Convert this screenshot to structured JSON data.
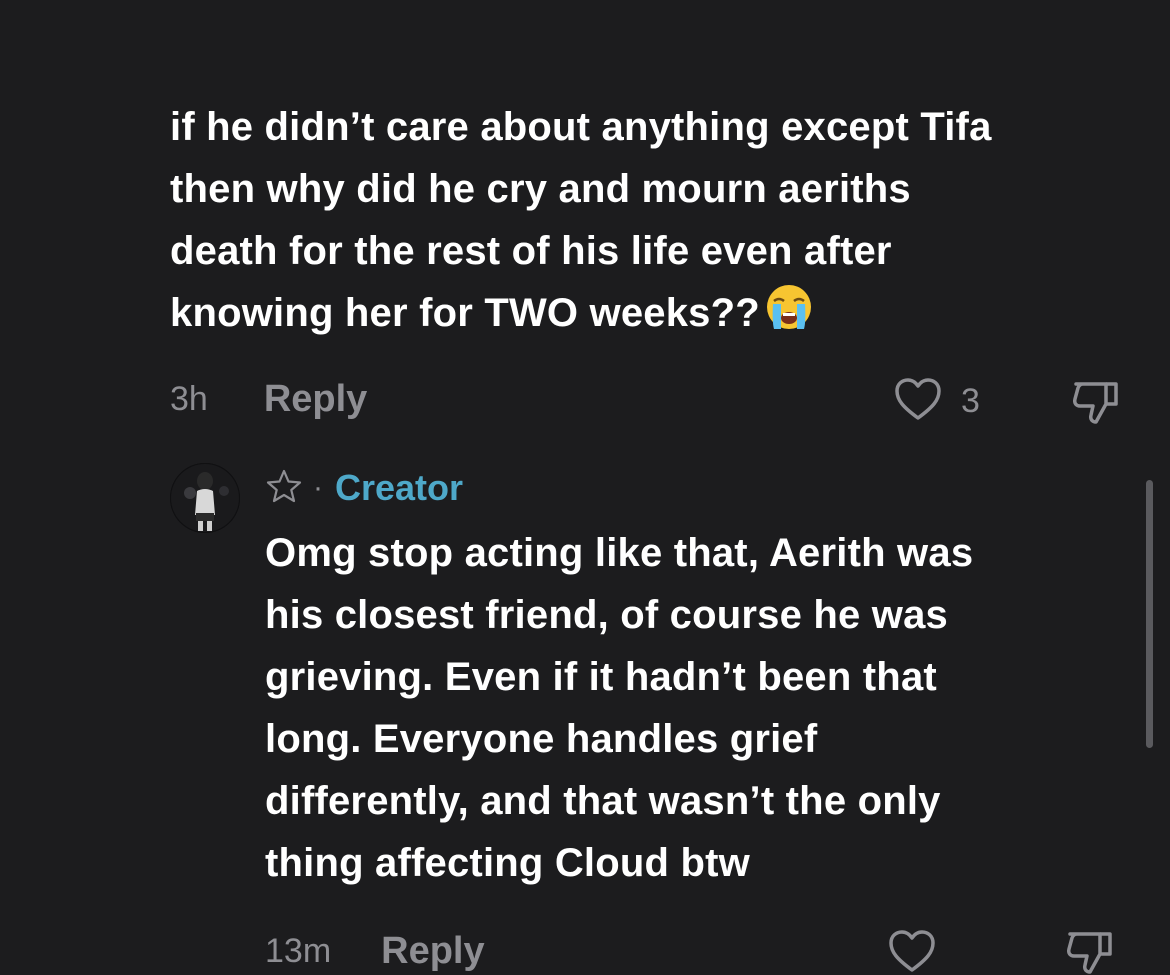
{
  "parent_comment": {
    "text": "if he didn’t care about anything except Tifa\nthen why did he cry and mourn aeriths\ndeath for the rest of his life even after\nknowing her for TWO weeks??",
    "emoji_name": "loudly-crying-face",
    "time": "3h",
    "reply_label": "Reply",
    "like_count": "3"
  },
  "reply_comment": {
    "badge": "Creator",
    "separator": "·",
    "text": "Omg stop acting like that, Aerith was\nhis closest friend, of course he was\ngrieving. Even if it hadn’t been that\nlong. Everyone handles grief\ndifferently, and that wasn’t the only\nthing affecting Cloud btw",
    "time": "13m",
    "reply_label": "Reply"
  },
  "colors": {
    "background": "#1c1c1e",
    "text": "#ffffff",
    "muted": "#8e8e93",
    "creator_accent": "#4ea8c9"
  },
  "icons": [
    "heart-icon",
    "dislike-icon",
    "star-icon",
    "crying-emoji-icon"
  ]
}
